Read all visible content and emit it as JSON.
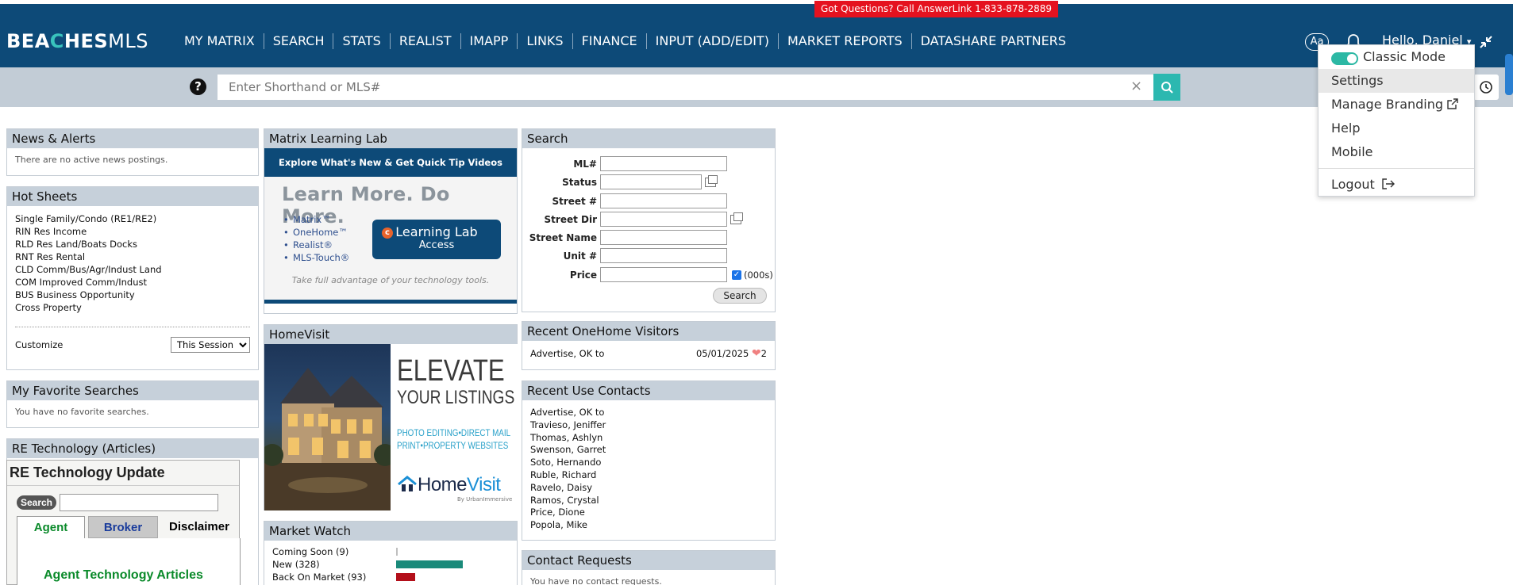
{
  "header": {
    "banner": "Got Questions? Call AnswerLink 1-833-878-2889",
    "logo_bold_1": "BEA",
    "logo_accent": "C",
    "logo_bold_2": "HES",
    "logo_thin": "MLS",
    "nav": [
      "MY MATRIX",
      "SEARCH",
      "STATS",
      "REALIST",
      "IMAPP",
      "LINKS",
      "FINANCE",
      "INPUT (ADD/EDIT)",
      "MARKET REPORTS",
      "DATASHARE PARTNERS"
    ],
    "font_size_btn": "Aa",
    "greeting": "Hello, Daniel"
  },
  "searchbar": {
    "help_glyph": "?",
    "placeholder": "Enter Shorthand or MLS#",
    "clear_glyph": "×"
  },
  "user_menu": {
    "classic_mode": "Classic Mode",
    "settings": "Settings",
    "manage_branding": "Manage Branding",
    "help": "Help",
    "mobile": "Mobile",
    "logout": "Logout"
  },
  "news": {
    "title": "News & Alerts",
    "empty": "There are no active news postings."
  },
  "hot_sheets": {
    "title": "Hot Sheets",
    "items": [
      "Single Family/Condo (RE1/RE2)",
      "RIN Res Income",
      "RLD Res Land/Boats Docks",
      "RNT Res Rental",
      "CLD Comm/Bus/Agr/Indust Land",
      "COM Improved Comm/Indust",
      "BUS Business Opportunity",
      "Cross Property"
    ],
    "customize": "Customize",
    "session_select": "This Session"
  },
  "favorites": {
    "title": "My Favorite Searches",
    "empty": "You have no favorite searches."
  },
  "re_tech": {
    "title": "RE Technology (Articles)",
    "widget_title": "RE Technology Update",
    "search_btn": "Search",
    "tabs": [
      "Agent",
      "Broker",
      "Disclaimer"
    ],
    "agent_heading": "Agent Technology Articles"
  },
  "learning_lab": {
    "title": "Matrix Learning Lab",
    "banner": "Explore What's New & Get Quick Tip Videos",
    "headline": "Learn More. Do More.",
    "products": [
      "Matrix™",
      "OneHome™",
      "Realist®",
      "MLS-Touch®"
    ],
    "button_line1": "Learning Lab",
    "button_line2": "Access",
    "footer": "Take full advantage of your technology tools."
  },
  "homevisit": {
    "title": "HomeVisit",
    "elevate": "ELEVATE",
    "your_listings": "YOUR LISTINGS",
    "services_1": "PHOTO EDITING•DIRECT MAIL",
    "services_2": "PRINT•PROPERTY WEBSITES",
    "brand_1": "Home",
    "brand_2": "Visit",
    "by": "By UrbanImmersive"
  },
  "market_watch": {
    "title": "Market Watch",
    "rows": [
      {
        "label": "Coming Soon (9)",
        "value": 9,
        "color": "#bfbfbf"
      },
      {
        "label": "New (328)",
        "value": 328,
        "color": "#1a8a7a"
      },
      {
        "label": "Back On Market (93)",
        "value": 93,
        "color": "#b30f1a"
      }
    ]
  },
  "search_panel": {
    "title": "Search",
    "fields": [
      "ML#",
      "Status",
      "Street #",
      "Street Dir",
      "Street Name",
      "Unit #",
      "Price"
    ],
    "price_unit": "(000s)",
    "check_glyph": "✓",
    "button": "Search"
  },
  "visitors": {
    "title": "Recent OneHome Visitors",
    "name": "Advertise, OK to",
    "date": "05/01/2025",
    "count": "2"
  },
  "contacts": {
    "title": "Recent Use Contacts",
    "items": [
      "Advertise, OK to",
      "Travieso, Jeniffer",
      "Thomas, Ashlyn",
      "Swenson, Garret",
      "Soto, Hernando",
      "Ruble, Richard",
      "Ravelo, Daisy",
      "Ramos, Crystal",
      "Price, Dione",
      "Popola, Mike"
    ]
  },
  "contact_requests": {
    "title": "Contact Requests",
    "empty": "You have no contact requests."
  },
  "colors": {
    "nav_bg": "#0d4a78",
    "accent": "#2cb8b0",
    "banner_red": "#e5121f",
    "panel_header": "#c6d0da"
  }
}
